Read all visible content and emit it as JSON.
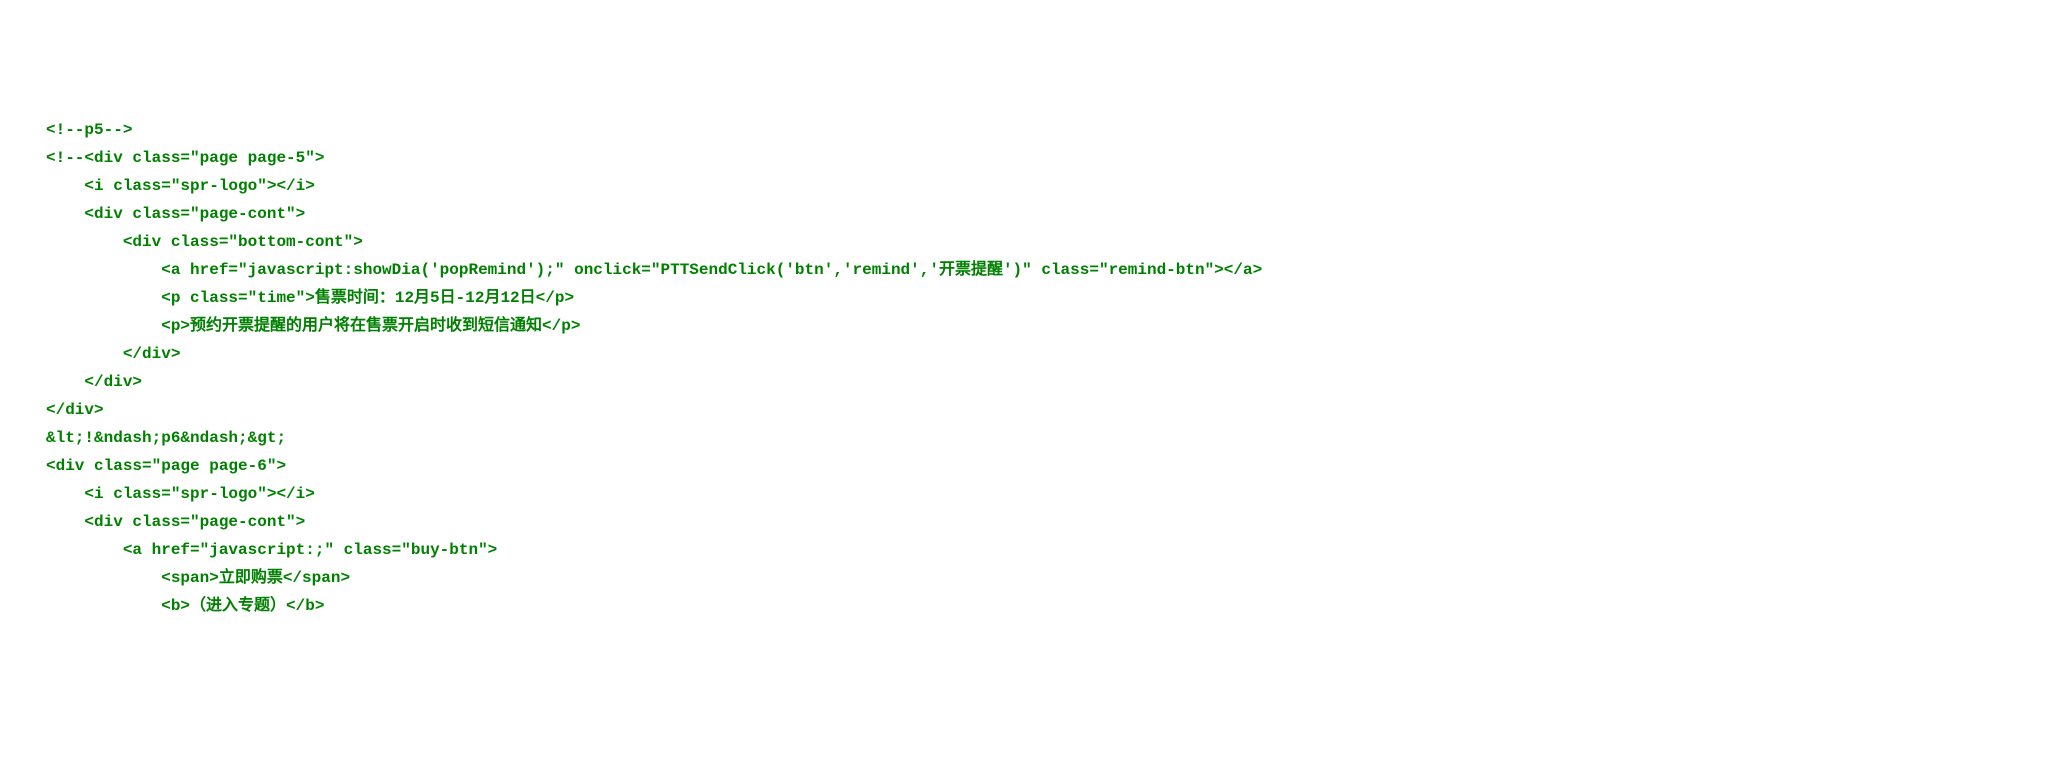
{
  "code": {
    "lines": [
      {
        "indent": 0,
        "text": "<!--p5-->"
      },
      {
        "indent": 0,
        "text": "<!--<div class=\"page page-5\">"
      },
      {
        "indent": 1,
        "text": "<i class=\"spr-logo\"></i>"
      },
      {
        "indent": 1,
        "text": "<div class=\"page-cont\">"
      },
      {
        "indent": 2,
        "text": "<div class=\"bottom-cont\">"
      },
      {
        "indent": 3,
        "text": "<a href=\"javascript:showDia('popRemind');\" onclick=\"PTTSendClick('btn','remind','开票提醒')\" class=\"remind-btn\"></a>"
      },
      {
        "indent": 3,
        "text": "<p class=\"time\">售票时间：12月5日-12月12日</p>"
      },
      {
        "indent": 3,
        "text": "<p>预约开票提醒的用户将在售票开启时收到短信通知</p>"
      },
      {
        "indent": 2,
        "text": "</div>"
      },
      {
        "indent": 1,
        "text": "</div>"
      },
      {
        "indent": 0,
        "text": "</div>"
      },
      {
        "indent": 0,
        "text": "&lt;!&ndash;p6&ndash;&gt;"
      },
      {
        "indent": 0,
        "text": "<div class=\"page page-6\">"
      },
      {
        "indent": 1,
        "text": "<i class=\"spr-logo\"></i>"
      },
      {
        "indent": 1,
        "text": "<div class=\"page-cont\">"
      },
      {
        "indent": 2,
        "text": "<a href=\"javascript:;\" class=\"buy-btn\">"
      },
      {
        "indent": 3,
        "text": "<span>立即购票</span>"
      },
      {
        "indent": 3,
        "text": "<b>（进入专题）</b>"
      }
    ]
  }
}
